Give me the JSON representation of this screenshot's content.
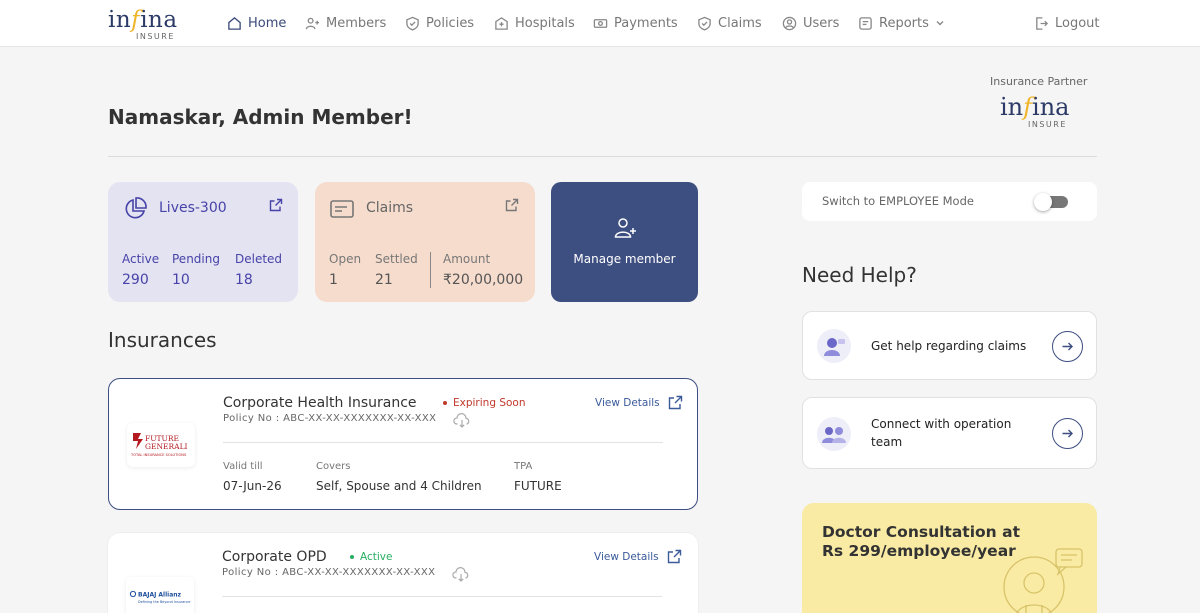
{
  "brand": {
    "name_a": "in",
    "name_f": "f",
    "name_b": "ina",
    "tagline": "INSURE"
  },
  "nav": {
    "items": [
      {
        "label": "Home",
        "icon": "home-icon"
      },
      {
        "label": "Members",
        "icon": "members-icon"
      },
      {
        "label": "Policies",
        "icon": "shield-check-icon"
      },
      {
        "label": "Hospitals",
        "icon": "hospital-icon"
      },
      {
        "label": "Payments",
        "icon": "payments-icon"
      },
      {
        "label": "Claims",
        "icon": "claims-shield-icon"
      },
      {
        "label": "Users",
        "icon": "user-circle-icon"
      },
      {
        "label": "Reports",
        "icon": "reports-icon"
      }
    ],
    "logout": "Logout"
  },
  "header": {
    "greeting": "Namaskar, Admin Member!",
    "partner_label": "Insurance Partner"
  },
  "lives": {
    "title": "Lives-300",
    "stats": [
      {
        "label": "Active",
        "value": "290"
      },
      {
        "label": "Pending",
        "value": "10"
      },
      {
        "label": "Deleted",
        "value": "18"
      }
    ]
  },
  "claims": {
    "title": "Claims",
    "stats": [
      {
        "label": "Open",
        "value": "1"
      },
      {
        "label": "Settled",
        "value": "21"
      },
      {
        "label": "Amount",
        "value": "₹20,00,000"
      }
    ]
  },
  "manage": {
    "label": "Manage member"
  },
  "insurances": {
    "title": "Insurances",
    "policies": [
      {
        "name": "Corporate Health Insurance",
        "status": "Expiring Soon",
        "status_color": "#c0392b",
        "policy_no": "Policy No : ABC-XX-XX-XXXXXXX-XX-XXX",
        "view": "View Details",
        "insurer_line1": "FUTURE",
        "insurer_line2": "GENERALI",
        "insurer_line3": "TOTAL INSURANCE SOLUTIONS",
        "cols": [
          {
            "label": "Valid till",
            "value": "07-Jun-26"
          },
          {
            "label": "Covers",
            "value": "Self, Spouse and 4 Children"
          },
          {
            "label": "TPA",
            "value": "FUTURE"
          }
        ]
      },
      {
        "name": "Corporate OPD",
        "status": "Active",
        "status_color": "#27ae60",
        "policy_no": "Policy No : ABC-XX-XX-XXXXXXX-XX-XXX",
        "view": "View Details",
        "insurer_line1": "BAJAJ Allianz",
        "insurer_line2": "Defining the Beyond Insurance"
      }
    ]
  },
  "right": {
    "switch_label": "Switch to EMPLOYEE Mode",
    "help_title": "Need Help?",
    "help_items": [
      "Get help regarding claims",
      "Connect with operation team"
    ],
    "promo": "Doctor Consultation at Rs 299/employee/year"
  }
}
